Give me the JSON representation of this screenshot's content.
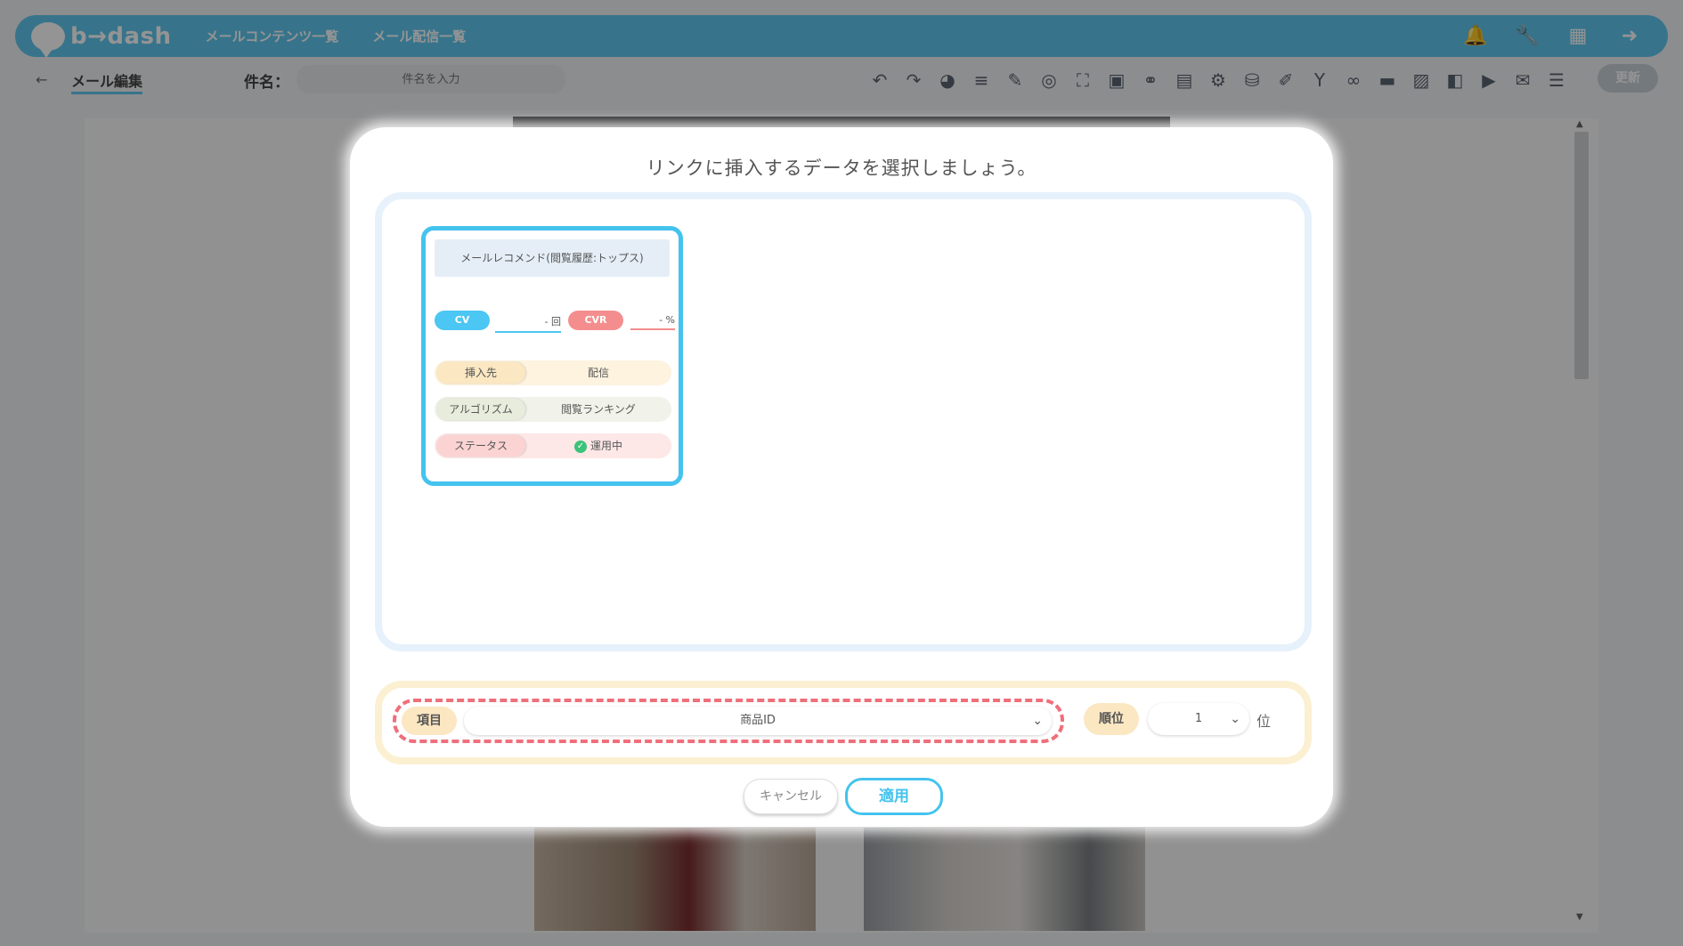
{
  "app": {
    "logo_text": "b→dash",
    "nav_links": [
      "メールコンテンツ一覧",
      "メール配信一覧"
    ],
    "nav_icons": [
      "bell-icon",
      "wrench-icon",
      "grid-icon",
      "logout-icon"
    ]
  },
  "toolbar": {
    "back_title": "メール編集",
    "subject_label": "件名：",
    "subject_placeholder": "件名を入力",
    "update_label": "更新"
  },
  "modal": {
    "title": "リンクに挿入するデータを選択しましょう。",
    "card": {
      "title": "メールレコメンド(閲覧履歴:トップス)",
      "cv_label": "CV",
      "cv_value": "- 回",
      "cvr_label": "CVR",
      "cvr_value": "- %",
      "rows": [
        {
          "label": "挿入先",
          "value": "配信"
        },
        {
          "label": "アルゴリズム",
          "value": "閲覧ランキング"
        },
        {
          "label": "ステータス",
          "value": "運用中"
        }
      ]
    },
    "item_label": "項目",
    "item_value": "商品ID",
    "rank_label": "順位",
    "rank_value": "1",
    "rank_unit": "位",
    "cancel_label": "キャンセル",
    "apply_label": "適用"
  },
  "colors": {
    "brand_blue": "#5fc9f0",
    "cv_blue": "#4cc6f2",
    "cvr_red": "#f48e8e",
    "highlight_dash": "#ef6f7a",
    "status_green": "#3cc27a"
  }
}
